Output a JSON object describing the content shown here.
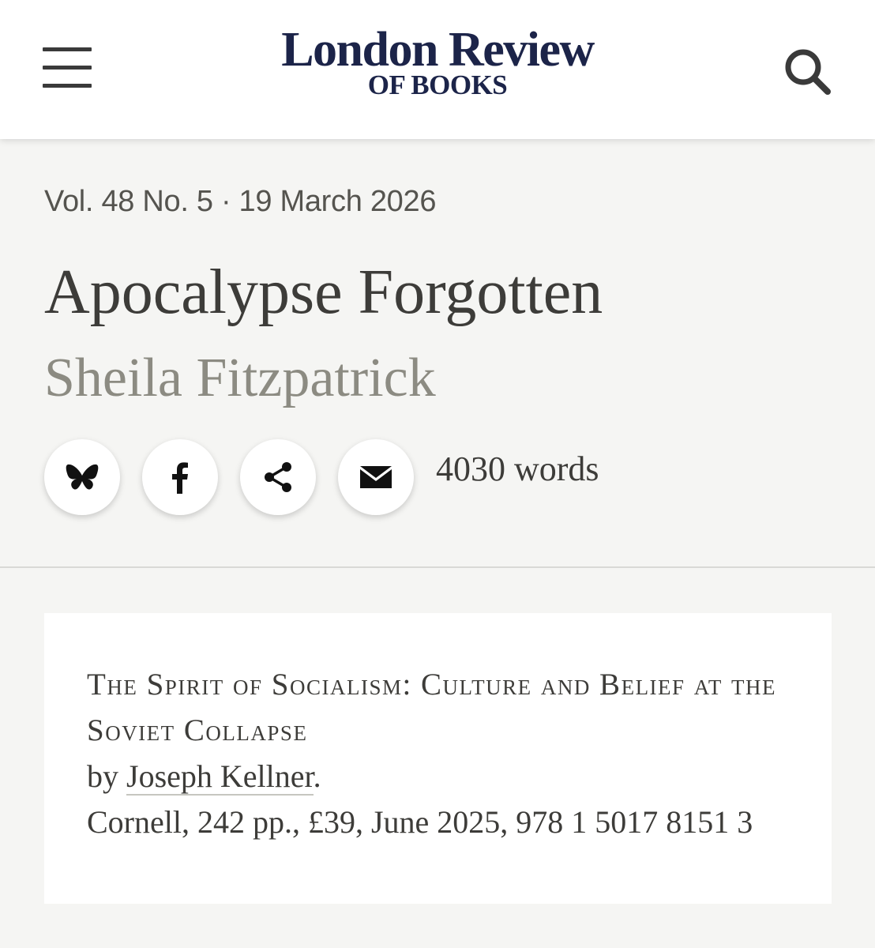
{
  "header": {
    "logo_line1": "London Review",
    "logo_line2": "OF BOOKS",
    "menu_icon": "hamburger-menu-icon",
    "search_icon": "search-icon",
    "brand_color": "#1c2449"
  },
  "article": {
    "issue_meta": "Vol. 48 No. 5 · 19 March 2026",
    "title": "Apocalypse Forgotten",
    "author": "Sheila Fitzpatrick",
    "word_count": "4030 words",
    "share_icons": [
      "bluesky-icon",
      "facebook-icon",
      "share-icon",
      "email-icon"
    ]
  },
  "book": {
    "title": "The Spirit of Socialism: Culture and Belief at the Soviet Collapse",
    "by_prefix": "by",
    "author": "Joseph Kellner",
    "after_author": ".",
    "details": "Cornell, 242 pp., £39, June 2025, 978 1 5017 8151 3"
  }
}
